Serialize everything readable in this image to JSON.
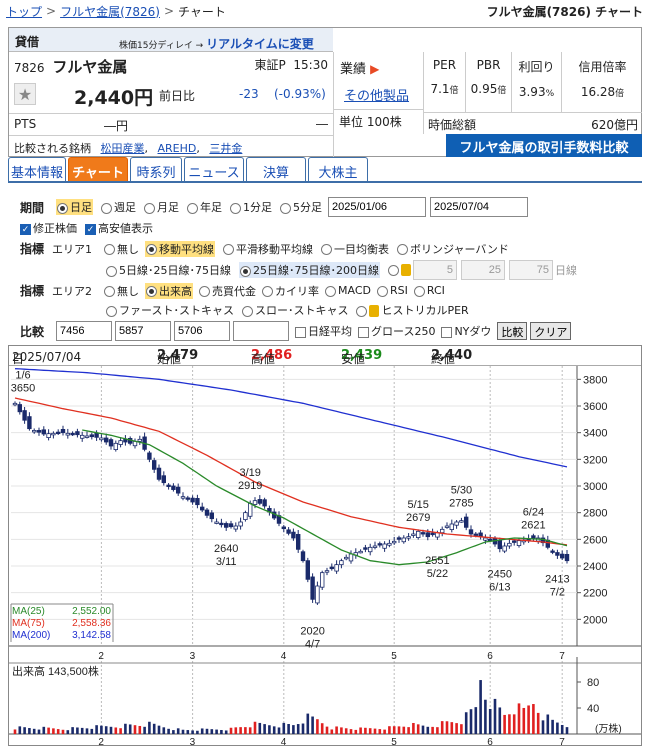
{
  "breadcrumb": {
    "top": "トップ",
    "stock_link": "フルヤ金属(7826)",
    "current": "チャート",
    "page_title": "フルヤ金属(7826) チャート"
  },
  "stock": {
    "kashaku": "貸借",
    "delay_note": "株価15分ディレイ →",
    "realtime_link": "リアルタイムに変更",
    "code": "7826",
    "name": "フルヤ金属",
    "market": "東証P",
    "time": "15:30",
    "price": "2,440円",
    "prev_label": "前日比",
    "change": "-23",
    "change_pct": "(-0.93%)",
    "pts_label": "PTS",
    "pts_value": "―円",
    "pts_diff": "―",
    "compare_label": "比較される銘柄",
    "compare": [
      "松田産業",
      "AREHD",
      "三井金"
    ],
    "gyoseki_label": "業績",
    "sonota": "その他製品",
    "unit": "単位 100株",
    "ratios": [
      {
        "h": "PER",
        "v": "7.1",
        "u": "倍"
      },
      {
        "h": "PBR",
        "v": "0.95",
        "u": "倍"
      },
      {
        "h": "利回り",
        "v": "3.93",
        "u": "%"
      },
      {
        "h": "信用倍率",
        "v": "16.28",
        "u": "倍"
      }
    ],
    "mcap_label": "時価総額",
    "mcap": "620億円",
    "fee_button": "フルヤ金属の取引手数料比較"
  },
  "tabs": [
    "基本情報",
    "チャート",
    "時系列",
    "ニュース",
    "決算",
    "大株主"
  ],
  "form": {
    "period_label": "期間",
    "periods": [
      "日足",
      "週足",
      "月足",
      "年足",
      "1分足",
      "5分足"
    ],
    "period_selected": 0,
    "date_from": "2025/01/06",
    "date_to": "2025/07/04",
    "chk_adjust": "修正株価",
    "chk_high": "高安値表示",
    "ind_label": "指標",
    "area1": "エリア1",
    "area2": "エリア2",
    "a1_opts": [
      "無し",
      "移動平均線",
      "平滑移動平均線",
      "一目均衡表",
      "ボリンジャーバンド"
    ],
    "ma_opts": [
      "5日線･25日線･75日線",
      "25日線･75日線･200日線"
    ],
    "ma_custom": [
      "5",
      "25",
      "75"
    ],
    "day_unit": "日線",
    "a2_row1": [
      "無し",
      "出来高",
      "売買代金",
      "カイリ率",
      "MACD",
      "RSI",
      "RCI"
    ],
    "a2_row2": [
      "ファースト･ストキャス",
      "スロー･ストキャス",
      "ヒストリカルPER"
    ],
    "cmp_label": "比較",
    "cmp_codes": [
      "7456",
      "5857",
      "5706",
      ""
    ],
    "cmp_chk": [
      "日経平均",
      "グロース250",
      "NYダウ"
    ],
    "btn_compare": "比較",
    "btn_clear": "クリア"
  },
  "chart_header": {
    "date_label": "日付",
    "date": "2025/07/04",
    "open_l": "始値",
    "open": "2,479",
    "high_l": "高値",
    "high": "2,486",
    "low_l": "安値",
    "low": "2,439",
    "close_l": "終値",
    "close": "2,440"
  },
  "legend": [
    {
      "label": "MA(25)",
      "value": "2,552.00",
      "color": "#2a8a2a"
    },
    {
      "label": "MA(75)",
      "value": "2,558.36",
      "color": "#e03020"
    },
    {
      "label": "MA(200)",
      "value": "3,142.58",
      "color": "#2030d0"
    }
  ],
  "volume_header": {
    "label": "出来高",
    "value": "143,500株"
  },
  "volume_unit": "(万株)",
  "chart_data": {
    "type": "candlestick",
    "yaxis": {
      "ticks": [
        2000,
        2200,
        2400,
        2600,
        2800,
        3000,
        3200,
        3400,
        3600,
        3800
      ],
      "range": [
        1800,
        3900
      ]
    },
    "xaxis": {
      "ticks": [
        "2",
        "3",
        "4",
        "5",
        "6",
        "7"
      ]
    },
    "vol_axis": {
      "ticks": [
        40,
        80
      ],
      "range": [
        0,
        100
      ]
    },
    "annotations": [
      {
        "date": "1/6",
        "value": "3650",
        "pos": "above"
      },
      {
        "date": "3/11",
        "value": "2640",
        "pos": "below"
      },
      {
        "date": "3/19",
        "value": "2919",
        "pos": "above"
      },
      {
        "date": "4/7",
        "value": "2020",
        "pos": "below"
      },
      {
        "date": "5/15",
        "value": "2679",
        "pos": "above"
      },
      {
        "date": "5/22",
        "value": "2551",
        "pos": "below"
      },
      {
        "date": "5/30",
        "value": "2785",
        "pos": "above"
      },
      {
        "date": "6/13",
        "value": "2450",
        "pos": "below"
      },
      {
        "date": "6/24",
        "value": "2621",
        "pos": "above"
      },
      {
        "date": "7/2",
        "value": "2413",
        "pos": "below"
      }
    ],
    "close_anchor": [
      [
        0,
        3620
      ],
      [
        3,
        3430
      ],
      [
        6,
        3390
      ],
      [
        10,
        3400
      ],
      [
        14,
        3380
      ],
      [
        18,
        3360
      ],
      [
        20,
        3300
      ],
      [
        22,
        3340
      ],
      [
        24,
        3320
      ],
      [
        26,
        3350
      ],
      [
        28,
        3200
      ],
      [
        30,
        3050
      ],
      [
        32,
        3000
      ],
      [
        35,
        2920
      ],
      [
        38,
        2860
      ],
      [
        40,
        2780
      ],
      [
        42,
        2730
      ],
      [
        44,
        2690
      ],
      [
        46,
        2700
      ],
      [
        47,
        2730
      ],
      [
        49,
        2870
      ],
      [
        50,
        2890
      ],
      [
        52,
        2850
      ],
      [
        54,
        2760
      ],
      [
        56,
        2680
      ],
      [
        58,
        2610
      ],
      [
        60,
        2440
      ],
      [
        61,
        2300
      ],
      [
        62,
        2150
      ],
      [
        63,
        2250
      ],
      [
        64,
        2350
      ],
      [
        66,
        2380
      ],
      [
        68,
        2440
      ],
      [
        70,
        2490
      ],
      [
        72,
        2510
      ],
      [
        74,
        2540
      ],
      [
        76,
        2560
      ],
      [
        78,
        2570
      ],
      [
        80,
        2600
      ],
      [
        82,
        2620
      ],
      [
        84,
        2660
      ],
      [
        86,
        2620
      ],
      [
        88,
        2650
      ],
      [
        90,
        2700
      ],
      [
        92,
        2730
      ],
      [
        93,
        2740
      ],
      [
        95,
        2640
      ],
      [
        97,
        2620
      ],
      [
        99,
        2600
      ],
      [
        101,
        2530
      ],
      [
        103,
        2570
      ],
      [
        105,
        2590
      ],
      [
        107,
        2600
      ],
      [
        109,
        2610
      ],
      [
        111,
        2540
      ],
      [
        113,
        2480
      ],
      [
        115,
        2440
      ]
    ],
    "volume_anchor": [
      [
        0,
        10
      ],
      [
        10,
        8
      ],
      [
        20,
        12
      ],
      [
        28,
        15
      ],
      [
        35,
        6
      ],
      [
        45,
        8
      ],
      [
        50,
        15
      ],
      [
        58,
        14
      ],
      [
        61,
        25
      ],
      [
        63,
        22
      ],
      [
        66,
        10
      ],
      [
        72,
        8
      ],
      [
        78,
        10
      ],
      [
        82,
        14
      ],
      [
        86,
        12
      ],
      [
        90,
        18
      ],
      [
        93,
        20
      ],
      [
        96,
        40
      ],
      [
        97,
        90
      ],
      [
        98,
        65
      ],
      [
        100,
        45
      ],
      [
        102,
        30
      ],
      [
        104,
        40
      ],
      [
        106,
        35
      ],
      [
        108,
        50
      ],
      [
        110,
        30
      ],
      [
        112,
        20
      ],
      [
        115,
        14
      ]
    ],
    "ma25_anchor": [
      [
        14,
        3420
      ],
      [
        20,
        3380
      ],
      [
        28,
        3310
      ],
      [
        35,
        3170
      ],
      [
        42,
        3000
      ],
      [
        50,
        2850
      ],
      [
        56,
        2760
      ],
      [
        62,
        2640
      ],
      [
        68,
        2520
      ],
      [
        74,
        2440
      ],
      [
        80,
        2410
      ],
      [
        86,
        2430
      ],
      [
        92,
        2500
      ],
      [
        98,
        2580
      ],
      [
        104,
        2610
      ],
      [
        110,
        2600
      ],
      [
        115,
        2552
      ]
    ],
    "ma75_anchor": [
      [
        0,
        3660
      ],
      [
        10,
        3580
      ],
      [
        20,
        3510
      ],
      [
        30,
        3410
      ],
      [
        40,
        3230
      ],
      [
        50,
        3030
      ],
      [
        60,
        2880
      ],
      [
        70,
        2770
      ],
      [
        80,
        2690
      ],
      [
        90,
        2640
      ],
      [
        100,
        2610
      ],
      [
        110,
        2580
      ],
      [
        115,
        2558
      ]
    ],
    "ma200_anchor": [
      [
        0,
        3880
      ],
      [
        15,
        3850
      ],
      [
        30,
        3800
      ],
      [
        45,
        3720
      ],
      [
        60,
        3620
      ],
      [
        75,
        3490
      ],
      [
        90,
        3360
      ],
      [
        105,
        3220
      ],
      [
        115,
        3143
      ]
    ]
  }
}
